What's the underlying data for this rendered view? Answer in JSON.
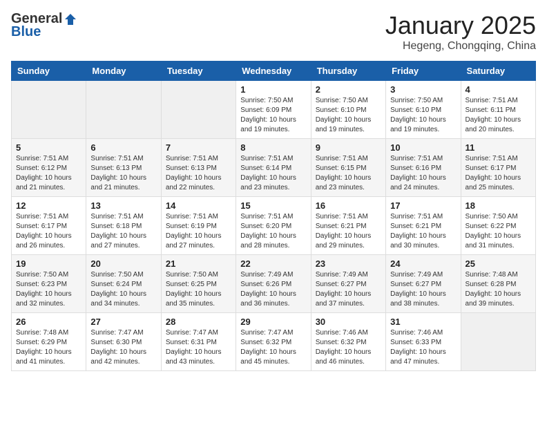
{
  "header": {
    "logo_general": "General",
    "logo_blue": "Blue",
    "month_title": "January 2025",
    "location": "Hegeng, Chongqing, China"
  },
  "weekdays": [
    "Sunday",
    "Monday",
    "Tuesday",
    "Wednesday",
    "Thursday",
    "Friday",
    "Saturday"
  ],
  "weeks": [
    {
      "row_class": "week-row-odd",
      "days": [
        {
          "num": "",
          "empty": true
        },
        {
          "num": "",
          "empty": true
        },
        {
          "num": "",
          "empty": true
        },
        {
          "num": "1",
          "info": "Sunrise: 7:50 AM\nSunset: 6:09 PM\nDaylight: 10 hours\nand 19 minutes."
        },
        {
          "num": "2",
          "info": "Sunrise: 7:50 AM\nSunset: 6:10 PM\nDaylight: 10 hours\nand 19 minutes."
        },
        {
          "num": "3",
          "info": "Sunrise: 7:50 AM\nSunset: 6:10 PM\nDaylight: 10 hours\nand 19 minutes."
        },
        {
          "num": "4",
          "info": "Sunrise: 7:51 AM\nSunset: 6:11 PM\nDaylight: 10 hours\nand 20 minutes."
        }
      ]
    },
    {
      "row_class": "week-row-even",
      "days": [
        {
          "num": "5",
          "info": "Sunrise: 7:51 AM\nSunset: 6:12 PM\nDaylight: 10 hours\nand 21 minutes."
        },
        {
          "num": "6",
          "info": "Sunrise: 7:51 AM\nSunset: 6:13 PM\nDaylight: 10 hours\nand 21 minutes."
        },
        {
          "num": "7",
          "info": "Sunrise: 7:51 AM\nSunset: 6:13 PM\nDaylight: 10 hours\nand 22 minutes."
        },
        {
          "num": "8",
          "info": "Sunrise: 7:51 AM\nSunset: 6:14 PM\nDaylight: 10 hours\nand 23 minutes."
        },
        {
          "num": "9",
          "info": "Sunrise: 7:51 AM\nSunset: 6:15 PM\nDaylight: 10 hours\nand 23 minutes."
        },
        {
          "num": "10",
          "info": "Sunrise: 7:51 AM\nSunset: 6:16 PM\nDaylight: 10 hours\nand 24 minutes."
        },
        {
          "num": "11",
          "info": "Sunrise: 7:51 AM\nSunset: 6:17 PM\nDaylight: 10 hours\nand 25 minutes."
        }
      ]
    },
    {
      "row_class": "week-row-odd",
      "days": [
        {
          "num": "12",
          "info": "Sunrise: 7:51 AM\nSunset: 6:17 PM\nDaylight: 10 hours\nand 26 minutes."
        },
        {
          "num": "13",
          "info": "Sunrise: 7:51 AM\nSunset: 6:18 PM\nDaylight: 10 hours\nand 27 minutes."
        },
        {
          "num": "14",
          "info": "Sunrise: 7:51 AM\nSunset: 6:19 PM\nDaylight: 10 hours\nand 27 minutes."
        },
        {
          "num": "15",
          "info": "Sunrise: 7:51 AM\nSunset: 6:20 PM\nDaylight: 10 hours\nand 28 minutes."
        },
        {
          "num": "16",
          "info": "Sunrise: 7:51 AM\nSunset: 6:21 PM\nDaylight: 10 hours\nand 29 minutes."
        },
        {
          "num": "17",
          "info": "Sunrise: 7:51 AM\nSunset: 6:21 PM\nDaylight: 10 hours\nand 30 minutes."
        },
        {
          "num": "18",
          "info": "Sunrise: 7:50 AM\nSunset: 6:22 PM\nDaylight: 10 hours\nand 31 minutes."
        }
      ]
    },
    {
      "row_class": "week-row-even",
      "days": [
        {
          "num": "19",
          "info": "Sunrise: 7:50 AM\nSunset: 6:23 PM\nDaylight: 10 hours\nand 32 minutes."
        },
        {
          "num": "20",
          "info": "Sunrise: 7:50 AM\nSunset: 6:24 PM\nDaylight: 10 hours\nand 34 minutes."
        },
        {
          "num": "21",
          "info": "Sunrise: 7:50 AM\nSunset: 6:25 PM\nDaylight: 10 hours\nand 35 minutes."
        },
        {
          "num": "22",
          "info": "Sunrise: 7:49 AM\nSunset: 6:26 PM\nDaylight: 10 hours\nand 36 minutes."
        },
        {
          "num": "23",
          "info": "Sunrise: 7:49 AM\nSunset: 6:27 PM\nDaylight: 10 hours\nand 37 minutes."
        },
        {
          "num": "24",
          "info": "Sunrise: 7:49 AM\nSunset: 6:27 PM\nDaylight: 10 hours\nand 38 minutes."
        },
        {
          "num": "25",
          "info": "Sunrise: 7:48 AM\nSunset: 6:28 PM\nDaylight: 10 hours\nand 39 minutes."
        }
      ]
    },
    {
      "row_class": "week-row-odd",
      "days": [
        {
          "num": "26",
          "info": "Sunrise: 7:48 AM\nSunset: 6:29 PM\nDaylight: 10 hours\nand 41 minutes."
        },
        {
          "num": "27",
          "info": "Sunrise: 7:47 AM\nSunset: 6:30 PM\nDaylight: 10 hours\nand 42 minutes."
        },
        {
          "num": "28",
          "info": "Sunrise: 7:47 AM\nSunset: 6:31 PM\nDaylight: 10 hours\nand 43 minutes."
        },
        {
          "num": "29",
          "info": "Sunrise: 7:47 AM\nSunset: 6:32 PM\nDaylight: 10 hours\nand 45 minutes."
        },
        {
          "num": "30",
          "info": "Sunrise: 7:46 AM\nSunset: 6:32 PM\nDaylight: 10 hours\nand 46 minutes."
        },
        {
          "num": "31",
          "info": "Sunrise: 7:46 AM\nSunset: 6:33 PM\nDaylight: 10 hours\nand 47 minutes."
        },
        {
          "num": "",
          "empty": true
        }
      ]
    }
  ]
}
